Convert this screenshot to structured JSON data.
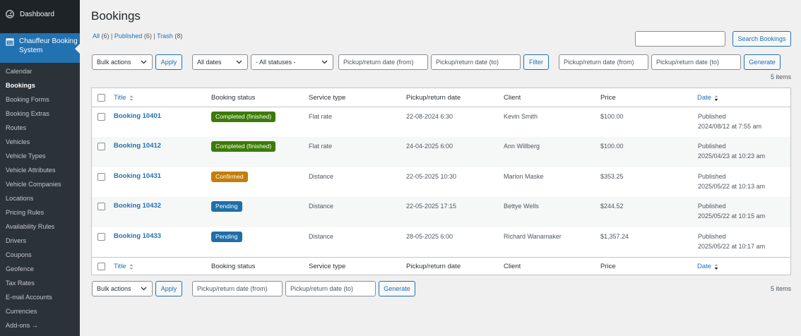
{
  "sidebar": {
    "dashboard": "Dashboard",
    "plugin": "Chauffeur Booking System",
    "items": [
      {
        "label": "Calendar",
        "current": false
      },
      {
        "label": "Bookings",
        "current": true
      },
      {
        "label": "Booking Forms",
        "current": false
      },
      {
        "label": "Booking Extras",
        "current": false
      },
      {
        "label": "Routes",
        "current": false
      },
      {
        "label": "Vehicles",
        "current": false
      },
      {
        "label": "Vehicle Types",
        "current": false
      },
      {
        "label": "Vehicle Attributes",
        "current": false
      },
      {
        "label": "Vehicle Companies",
        "current": false
      },
      {
        "label": "Locations",
        "current": false
      },
      {
        "label": "Pricing Rules",
        "current": false
      },
      {
        "label": "Availability Rules",
        "current": false
      },
      {
        "label": "Drivers",
        "current": false
      },
      {
        "label": "Coupons",
        "current": false
      },
      {
        "label": "Geofence",
        "current": false
      },
      {
        "label": "Tax Rates",
        "current": false
      },
      {
        "label": "E-mail Accounts",
        "current": false
      },
      {
        "label": "Currencies",
        "current": false
      },
      {
        "label": "Add-ons →",
        "current": false
      }
    ]
  },
  "page": {
    "title": "Bookings",
    "views": {
      "all": "All",
      "all_count": "(6)",
      "published": "Published",
      "published_count": "(6)",
      "trash": "Trash",
      "trash_count": "(8)"
    },
    "search_button": "Search Bookings",
    "search_value": ""
  },
  "top_nav": {
    "bulk_actions": "Bulk actions",
    "apply": "Apply",
    "dates": "All dates",
    "statuses": "- All statuses -",
    "from_placeholder": "Pickup/return date (from)",
    "to_placeholder": "Pickup/return date (to)",
    "filter": "Filter",
    "generate": "Generate",
    "count": "5 items"
  },
  "bottom_nav": {
    "bulk_actions": "Bulk actions",
    "apply": "Apply",
    "from_placeholder": "Pickup/return date (from)",
    "to_placeholder": "Pickup/return date (to)",
    "generate": "Generate",
    "count": "5 items"
  },
  "columns": {
    "title": "Title",
    "status": "Booking status",
    "service": "Service type",
    "pickup": "Pickup/return date",
    "client": "Client",
    "price": "Price",
    "date": "Date"
  },
  "bookings": [
    {
      "title": "Booking 10401",
      "status": "Completed (finished)",
      "status_color": "#3c7b05",
      "service": "Flat rate",
      "pickup": "22-08-2024 6:30",
      "client": "Kevin Smith",
      "price": "$100.00",
      "date_state": "Published",
      "date": "2024/08/12 at 7:55 am"
    },
    {
      "title": "Booking 10412",
      "status": "Completed (finished)",
      "status_color": "#3c7b05",
      "service": "Flat rate",
      "pickup": "24-04-2025 6:00",
      "client": "Ann Willberg",
      "price": "$100.00",
      "date_state": "Published",
      "date": "2025/04/23 at 10:23 am"
    },
    {
      "title": "Booking 10431",
      "status": "Confirmed",
      "status_color": "#c57e08",
      "service": "Distance",
      "pickup": "22-05-2025 10:30",
      "client": "Marion Maske",
      "price": "$353.25",
      "date_state": "Published",
      "date": "2025/05/22 at 10:13 am"
    },
    {
      "title": "Booking 10432",
      "status": "Pending",
      "status_color": "#1e6fa8",
      "service": "Distance",
      "pickup": "22-05-2025 17:15",
      "client": "Bettye Wells",
      "price": "$244.52",
      "date_state": "Published",
      "date": "2025/05/22 at 10:15 am"
    },
    {
      "title": "Booking 10433",
      "status": "Pending",
      "status_color": "#1e6fa8",
      "service": "Distance",
      "pickup": "28-05-2025 6:00",
      "client": "Richard Wanamaker",
      "price": "$1,357.24",
      "date_state": "Published",
      "date": "2025/05/22 at 10:17 am"
    }
  ]
}
